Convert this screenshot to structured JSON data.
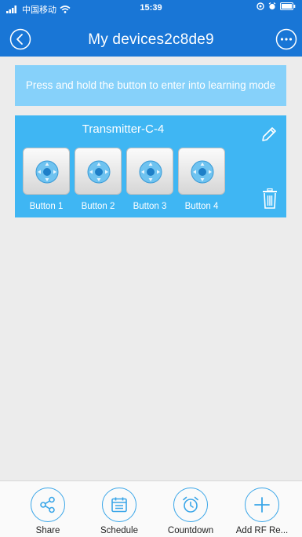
{
  "status_bar": {
    "carrier": "中国移动",
    "time": "15:39"
  },
  "header": {
    "title": "My devices2c8de9",
    "back_icon": "back-arrow-icon",
    "more_icon": "more-dots-icon"
  },
  "hint": "Press and hold the button to enter into learning mode",
  "device": {
    "name": "Transmitter-C-4",
    "buttons": [
      {
        "label": "Button 1",
        "icon": "dpad-icon"
      },
      {
        "label": "Button 2",
        "icon": "dpad-icon"
      },
      {
        "label": "Button 3",
        "icon": "dpad-icon"
      },
      {
        "label": "Button 4",
        "icon": "dpad-icon"
      }
    ],
    "edit_icon": "pencil-icon",
    "delete_icon": "trash-icon"
  },
  "tabbar": {
    "items": [
      {
        "label": "Share",
        "icon": "share-icon"
      },
      {
        "label": "Schedule",
        "icon": "calendar-icon"
      },
      {
        "label": "Countdown",
        "icon": "alarm-clock-icon"
      },
      {
        "label": "Add RF Re...",
        "icon": "plus-icon"
      }
    ]
  },
  "colors": {
    "header": "#1976d6",
    "hint_background": "#86d1fa",
    "card_background": "#3fb6f3",
    "tab_accent": "#3aa6e8",
    "page_background": "#ececec"
  }
}
